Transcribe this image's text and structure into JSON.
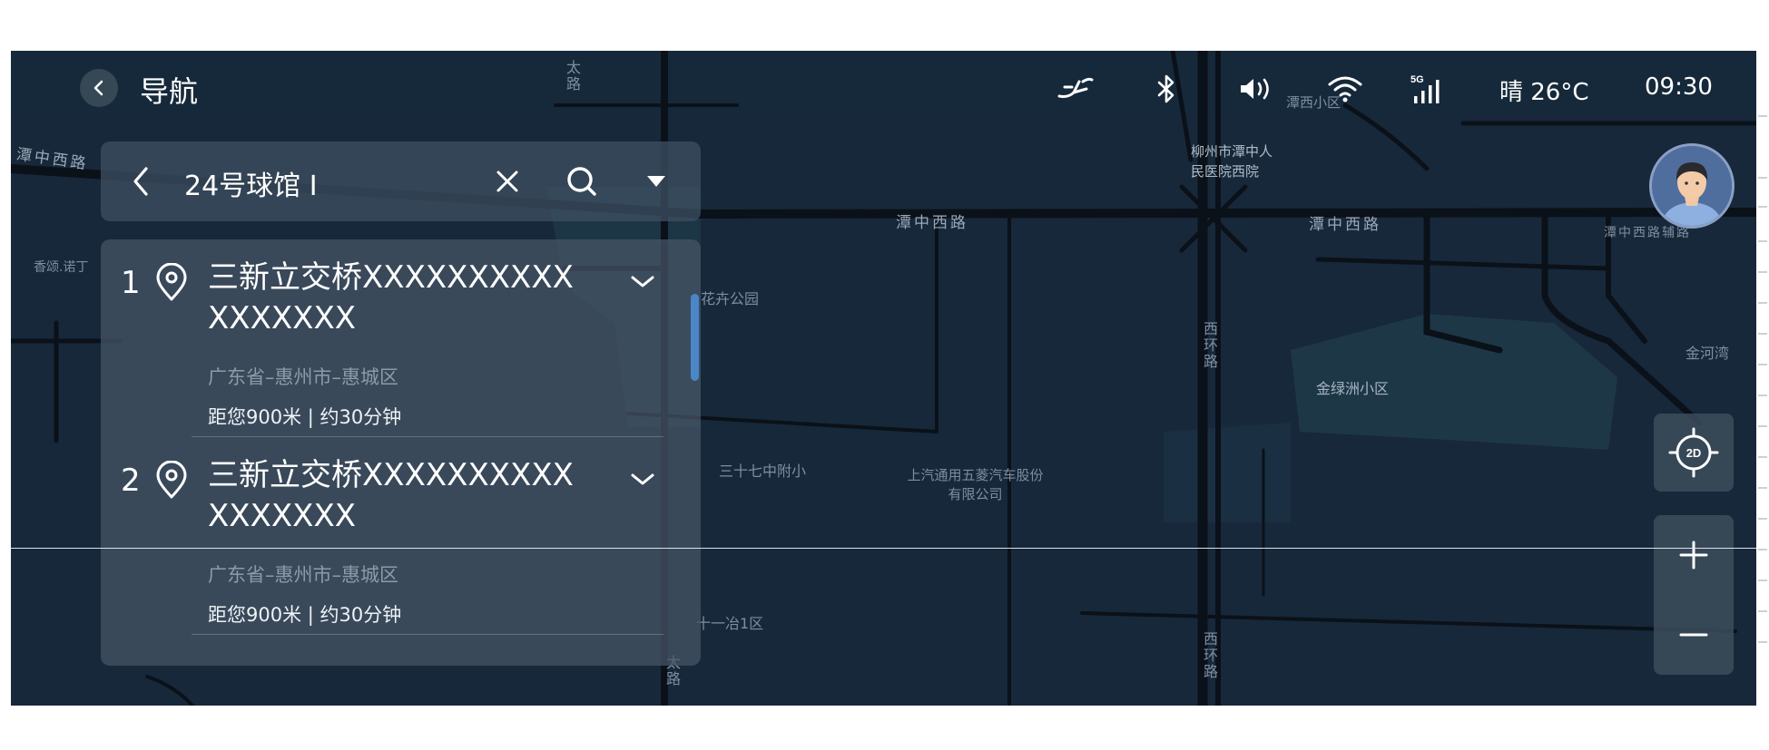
{
  "header": {
    "title": "导航"
  },
  "status_bar": {
    "weather": "晴 26°C",
    "time": "09:30",
    "signal_label": "5G"
  },
  "search": {
    "query": "24号球馆 I"
  },
  "results": [
    {
      "index": "1",
      "title": "三新立交桥XXXXXXXXXXXXXXXXX",
      "address": "广东省–惠州市–惠城区",
      "distance": "距您900米 | 约30分钟"
    },
    {
      "index": "2",
      "title": "三新立交桥XXXXXXXXXXXXXXXXX",
      "address": "广东省–惠州市–惠城区",
      "distance": "距您900米 | 约30分钟"
    }
  ],
  "map": {
    "labels": {
      "road_tanzhong_w1": "潭中西路",
      "road_tanzhong_w2": "潭中西路",
      "road_tanzhong_w3": "潭中西路",
      "road_tanzhong_aux": "潭中西路辅路",
      "road_xihuan_1": "西环路",
      "road_xihuan_2": "西环路",
      "road_tai_1": "太路",
      "road_tai_2": "太路",
      "hospital": "柳州市潭中人民医院西院",
      "tanxi": "潭西小区",
      "jinlvzhou": "金绿洲小区",
      "jinhewan": "金河湾",
      "park": "花卉公园",
      "school": "三十七中附小",
      "saic": "上汽通用五菱汽车股份有限公司",
      "xiangsong": "香颂.诺丁",
      "shiyiye": "十一冶1区"
    }
  },
  "map_controls": {
    "mode_label": "2D",
    "zoom_in": "+",
    "zoom_out": "−"
  },
  "colors": {
    "background": "#17283a",
    "panel": "#465666",
    "accent": "#4a86c8",
    "road": "#0b1119"
  }
}
